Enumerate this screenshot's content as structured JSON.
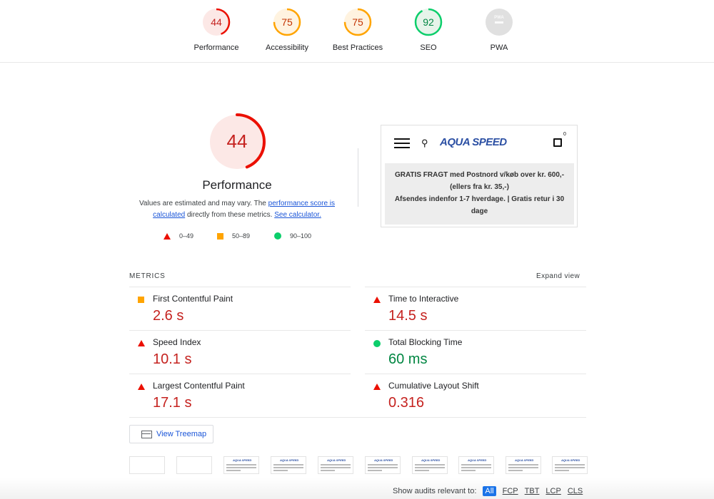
{
  "scores": [
    {
      "label": "Performance",
      "value": "44",
      "score": 0.44,
      "color": "#eb0f00",
      "bg": "#fce8e6",
      "text": "#c5221f"
    },
    {
      "label": "Accessibility",
      "value": "75",
      "score": 0.75,
      "color": "#ffa400",
      "bg": "#fff3e0",
      "text": "#c33300"
    },
    {
      "label": "Best Practices",
      "value": "75",
      "score": 0.75,
      "color": "#ffa400",
      "bg": "#fff3e0",
      "text": "#c33300"
    },
    {
      "label": "SEO",
      "value": "92",
      "score": 0.92,
      "color": "#0cce6b",
      "bg": "#e6f4ea",
      "text": "#018642"
    },
    {
      "label": "PWA",
      "value": "PWA",
      "score": 0,
      "color": "#cccccc",
      "bg": "#e0e0e0",
      "text": "#9e9e9e"
    }
  ],
  "main": {
    "score": "44",
    "score_fraction": 0.44,
    "title": "Performance",
    "desc_prefix": "Values are estimated and may vary. The ",
    "desc_link1": "performance score is calculated",
    "desc_mid": " directly from these metrics. ",
    "desc_link2": "See calculator."
  },
  "legend": [
    {
      "icon": "triangle-icon",
      "range": "0–49"
    },
    {
      "icon": "square-icon",
      "range": "50–89"
    },
    {
      "icon": "circle-icon",
      "range": "90–100"
    }
  ],
  "screenshot": {
    "logo": "AQUA SPEED",
    "cart_count": "0",
    "banner_lines": [
      "GRATIS FRAGT med Postnord v/køb over kr. 600,-",
      "(ellers fra kr. 35,-)",
      "Afsendes indenfor 1-7 hverdage. | Gratis retur i 30",
      "dage"
    ]
  },
  "metrics_heading": "METRICS",
  "expand_label": "Expand view",
  "metrics": [
    {
      "name": "First Contentful Paint",
      "value": "2.6 s",
      "status": "average"
    },
    {
      "name": "Time to Interactive",
      "value": "14.5 s",
      "status": "fail"
    },
    {
      "name": "Speed Index",
      "value": "10.1 s",
      "status": "fail"
    },
    {
      "name": "Total Blocking Time",
      "value": "60 ms",
      "status": "pass"
    },
    {
      "name": "Largest Contentful Paint",
      "value": "17.1 s",
      "status": "fail"
    },
    {
      "name": "Cumulative Layout Shift",
      "value": "0.316",
      "status": "fail"
    }
  ],
  "treemap_label": "View Treemap",
  "filmstrip_logo": "AQUA SPEED",
  "audits": {
    "label": "Show audits relevant to:",
    "filters": [
      "All",
      "FCP",
      "TBT",
      "LCP",
      "CLS"
    ]
  }
}
